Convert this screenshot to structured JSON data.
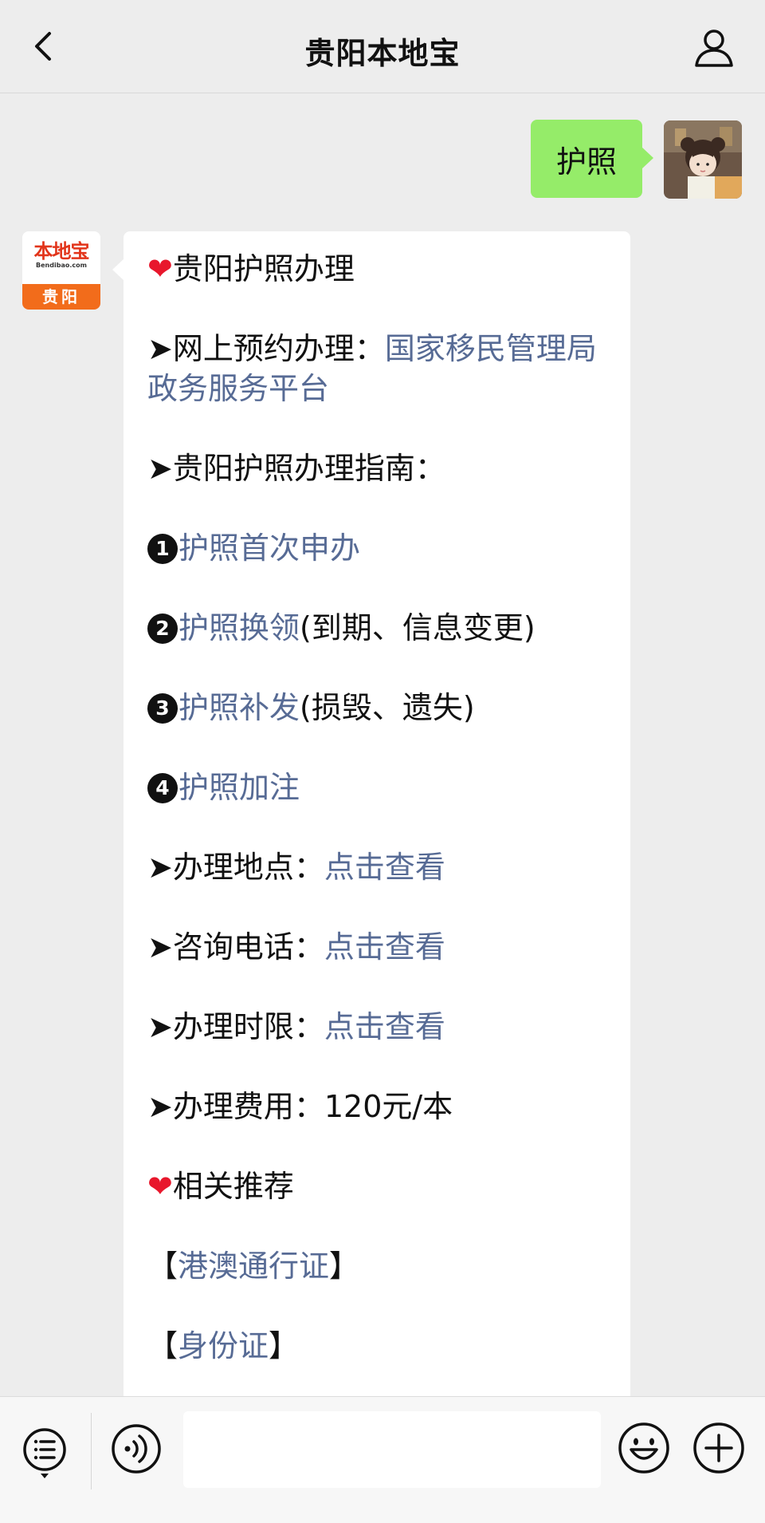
{
  "header": {
    "title": "贵阳本地宝",
    "back_icon": "chevron-left-icon",
    "profile_icon": "person-icon"
  },
  "user_message": {
    "text": "护照"
  },
  "bot_avatar": {
    "logo_main": "本地宝",
    "logo_sub": "Bendibao.com",
    "logo_city": "贵阳"
  },
  "bot_message": {
    "heading": "贵阳护照办理",
    "online_label": "➤网上预约办理：",
    "online_link_1": "国家移民管理局",
    "online_link_2": "政务服务平台",
    "guide_label": "➤贵阳护照办理指南：",
    "item1_num": "1",
    "item1_link": "护照首次申办",
    "item2_num": "2",
    "item2_link": "护照换领",
    "item2_note": "(到期、信息变更)",
    "item3_num": "3",
    "item3_link": "护照补发",
    "item3_note": "(损毁、遗失)",
    "item4_num": "4",
    "item4_link": "护照加注",
    "location_label": "➤办理地点：",
    "location_link": "点击查看",
    "phone_label": "➤咨询电话：",
    "phone_link": "点击查看",
    "time_label": "➤办理时限：",
    "time_link": "点击查看",
    "fee_label": "➤办理费用：",
    "fee_value": "120元/本",
    "recommend_heading": "相关推荐",
    "rec1_open": "【",
    "rec1_link": "港澳通行证",
    "rec1_close": "】",
    "rec2_open": "【",
    "rec2_link": "身份证",
    "rec2_close": "】"
  },
  "bottom_bar": {
    "menu_icon": "list-menu-icon",
    "voice_icon": "voice-icon",
    "input_value": "",
    "emoji_icon": "smiley-icon",
    "plus_icon": "plus-icon"
  },
  "colors": {
    "background": "#ededed",
    "outgoing_bubble": "#95ec69",
    "link": "#576b95",
    "heart": "#e8172c",
    "logo_orange": "#f26c1b"
  }
}
